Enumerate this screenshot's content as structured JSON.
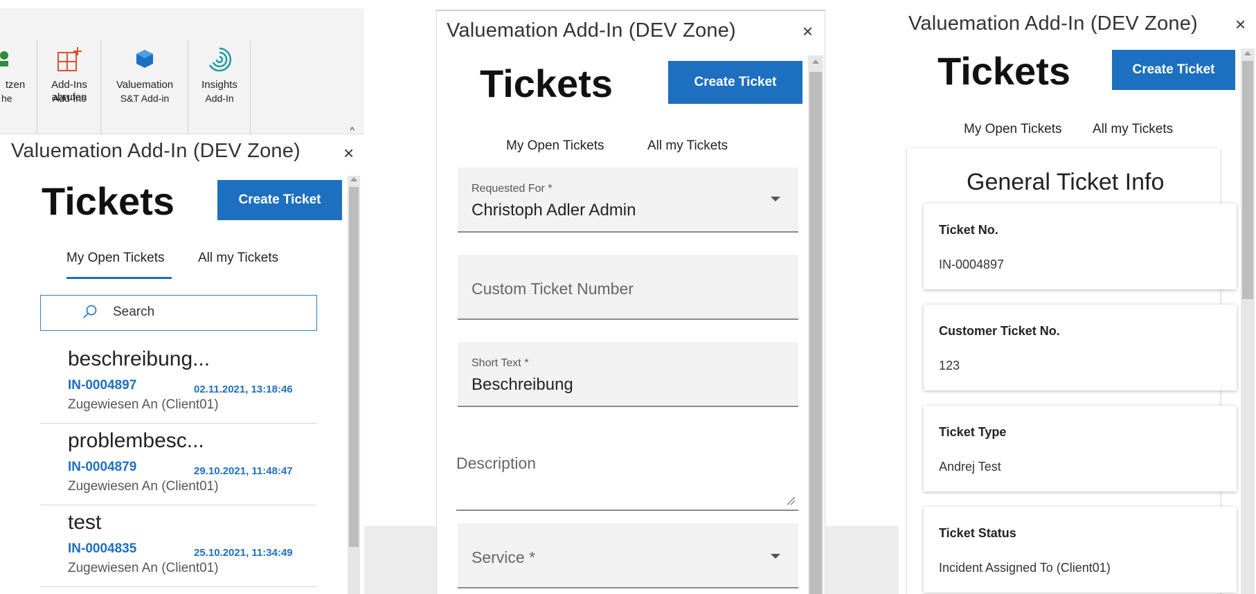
{
  "panel1": {
    "ribbon": {
      "buttons": [
        {
          "label": "tzen",
          "icon": "green-addin-icon"
        },
        {
          "label": "Add-Ins",
          "label2": "abrufen",
          "icon": "store-icon"
        },
        {
          "label": "Valuemation",
          "icon": "valuemation-icon"
        },
        {
          "label": "Insights",
          "icon": "insights-icon"
        }
      ],
      "groups": [
        "he",
        "Add-Ins",
        "S&T Add-in",
        "Add-In"
      ],
      "collapse": "^"
    },
    "pane_title": "Valuemation Add-In (DEV Zone)",
    "close": "×",
    "title": "Tickets",
    "create_button": "Create Ticket",
    "tabs": [
      "My Open Tickets",
      "All my Tickets"
    ],
    "search_placeholder": "Search",
    "tickets": [
      {
        "title": "beschreibung...",
        "id": "IN-0004897",
        "date": "02.11.2021, 13:18:46",
        "assigned": "Zugewiesen An (Client01)"
      },
      {
        "title": "problembesc...",
        "id": "IN-0004879",
        "date": "29.10.2021, 11:48:47",
        "assigned": "Zugewiesen An (Client01)"
      },
      {
        "title": "test",
        "id": "IN-0004835",
        "date": "25.10.2021, 11:34:49",
        "assigned": "Zugewiesen An (Client01)"
      }
    ]
  },
  "panel2": {
    "pane_title": "Valuemation Add-In (DEV Zone)",
    "close": "×",
    "title": "Tickets",
    "create_button": "Create Ticket",
    "tabs": [
      "My Open Tickets",
      "All my Tickets"
    ],
    "fields": {
      "requested_for": {
        "label": "Requested For *",
        "value": "Christoph Adler Admin"
      },
      "custom_ticket_number": {
        "placeholder": "Custom Ticket Number"
      },
      "short_text": {
        "label": "Short Text *",
        "value": "Beschreibung"
      },
      "description": {
        "placeholder": "Description"
      },
      "service": {
        "placeholder": "Service *"
      }
    }
  },
  "panel3": {
    "pane_title": "Valuemation Add-In (DEV Zone)",
    "close": "×",
    "title": "Tickets",
    "create_button": "Create Ticket",
    "tabs": [
      "My Open Tickets",
      "All my Tickets"
    ],
    "section_title": "General Ticket Info",
    "cards": [
      {
        "label": "Ticket No.",
        "value": "IN-0004897"
      },
      {
        "label": "Customer Ticket No.",
        "value": "123"
      },
      {
        "label": "Ticket Type",
        "value": "Andrej Test"
      },
      {
        "label": "Ticket Status",
        "value": "Incident Assigned To (Client01)"
      }
    ]
  },
  "colors": {
    "accent": "#1d6fc0",
    "field_bg": "#f2f2f2",
    "ribbon_bg": "#f3f3f3"
  }
}
